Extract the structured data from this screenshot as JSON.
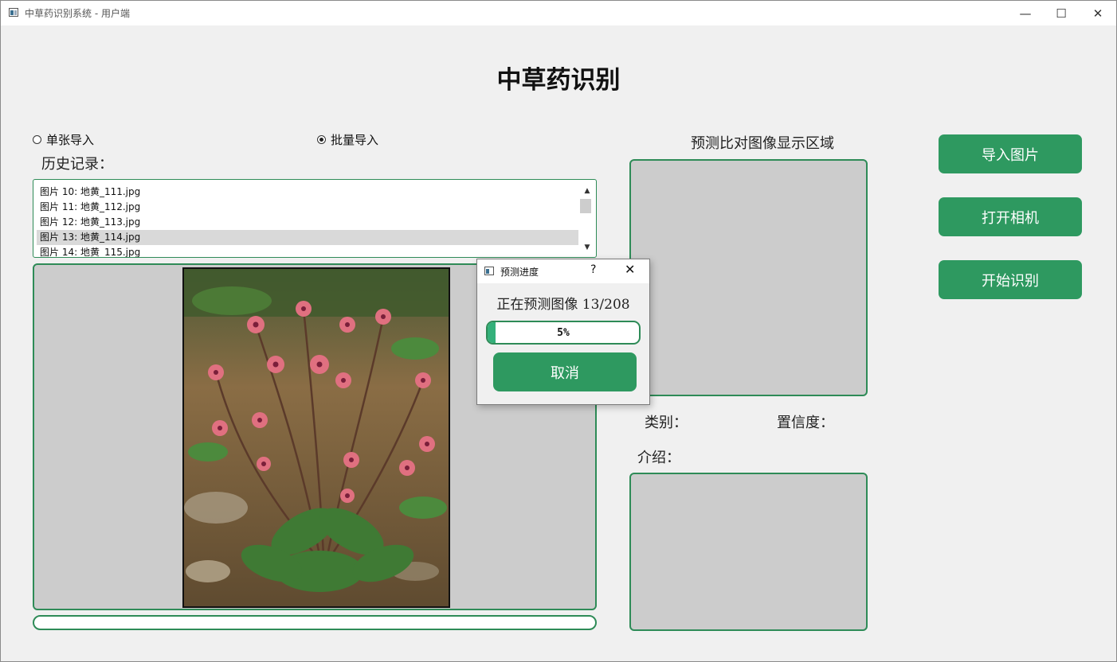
{
  "window": {
    "title": "中草药识别系统 - 用户端",
    "minimize_glyph": "—",
    "maximize_glyph": "☐",
    "close_glyph": "✕"
  },
  "page_title": "中草药识别",
  "import_mode": {
    "single_label": "单张导入",
    "batch_label": "批量导入",
    "selected": "batch"
  },
  "history": {
    "label": "历史记录：",
    "items": [
      "图片 10: 地黄_111.jpg",
      "图片 11: 地黄_112.jpg",
      "图片 12: 地黄_113.jpg",
      "图片 13: 地黄_114.jpg",
      "图片 14: 地黄_115.jpg"
    ],
    "selected_index": 3
  },
  "compare_area_label": "预测比对图像显示区域",
  "result": {
    "category_label": "类别：",
    "confidence_label": "置信度：",
    "intro_label": "介绍："
  },
  "actions": {
    "import_label": "导入图片",
    "camera_label": "打开相机",
    "recognize_label": "开始识别"
  },
  "dialog": {
    "title": "预测进度",
    "help_glyph": "?",
    "close_glyph": "✕",
    "status": "正在预测图像 13/208",
    "progress_percent": 5,
    "progress_text": "5%",
    "cancel_label": "取消"
  },
  "colors": {
    "accent": "#2e9960",
    "border": "#2e8b57",
    "panel_bg": "#cccccc",
    "window_bg": "#f0f0f0"
  }
}
